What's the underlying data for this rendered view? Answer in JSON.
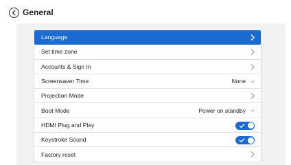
{
  "header": {
    "title": "General"
  },
  "settings": {
    "items": [
      {
        "label": "Language",
        "control": "chevron",
        "active": true
      },
      {
        "label": "Set time zone",
        "control": "chevron"
      },
      {
        "label": "Accounts & Sign In",
        "control": "chevron"
      },
      {
        "label": "Screensaver Time",
        "control": "dropdown",
        "value": "None"
      },
      {
        "label": "Projection Mode",
        "control": "chevron"
      },
      {
        "label": "Boot Mode",
        "control": "dropdown",
        "value": "Power on standby"
      },
      {
        "label": "HDMI Plug and Play",
        "control": "toggle",
        "on": true
      },
      {
        "label": "Keystroke Sound",
        "control": "toggle",
        "on": true
      },
      {
        "label": "Factory reset",
        "control": "chevron"
      }
    ]
  },
  "colors": {
    "accent": "#1a6ad2",
    "panel_bg": "#f2f2f2",
    "row_bg": "#ffffff"
  },
  "icons": {
    "back": "back-arrow-icon",
    "chevron": "chevron-right-icon",
    "dropdown": "chevron-down-icon",
    "toggle_check": "check-icon"
  }
}
